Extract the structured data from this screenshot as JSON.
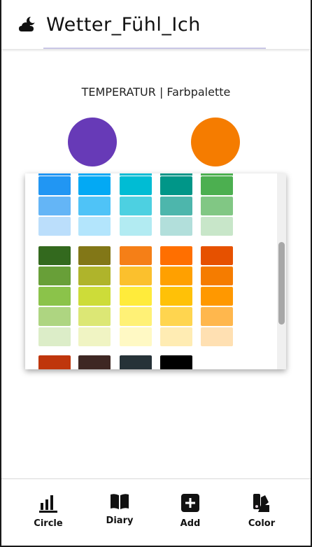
{
  "app": {
    "title": "Wetter_Fühl_Ich",
    "icon": "cloud-moon-icon"
  },
  "section": {
    "subtitle": "TEMPERATUR | Farbpalette"
  },
  "selected_colors": {
    "left": "#673ab7",
    "right": "#f57c00"
  },
  "palette": {
    "rows_top": [
      [
        "#2196f3",
        "#03a9f4",
        "#00bcd4",
        "#009688",
        "#4caf50"
      ],
      [
        "#64b5f6",
        "#4fc3f7",
        "#4dd0e1",
        "#4db6ac",
        "#81c784"
      ],
      [
        "#bbdefb",
        "#b3e5fc",
        "#b2ebf2",
        "#b2dfdb",
        "#c8e6c9"
      ]
    ],
    "rows_mid": [
      [
        "#33691e",
        "#827717",
        "#f57f17",
        "#ff6f00",
        "#e65100"
      ],
      [
        "#689f38",
        "#afb42b",
        "#fbc02d",
        "#ffa000",
        "#f57c00"
      ],
      [
        "#8bc34a",
        "#cddc39",
        "#ffeb3b",
        "#ffc107",
        "#ff9800"
      ],
      [
        "#aed581",
        "#dce775",
        "#fff176",
        "#ffd54f",
        "#ffb74d"
      ],
      [
        "#dcedc8",
        "#f0f4c3",
        "#fff9c4",
        "#ffecb3",
        "#ffe0b2"
      ]
    ],
    "rows_bottom": [
      [
        "#bf360c",
        "#3e2723",
        "#263238",
        "#000000"
      ]
    ]
  },
  "nav": {
    "items": [
      {
        "label": "Circle",
        "icon": "bar-chart-icon"
      },
      {
        "label": "Diary",
        "icon": "book-icon"
      },
      {
        "label": "Add",
        "icon": "add-box-icon"
      },
      {
        "label": "Color",
        "icon": "palette-icon"
      }
    ],
    "active": "Color"
  }
}
